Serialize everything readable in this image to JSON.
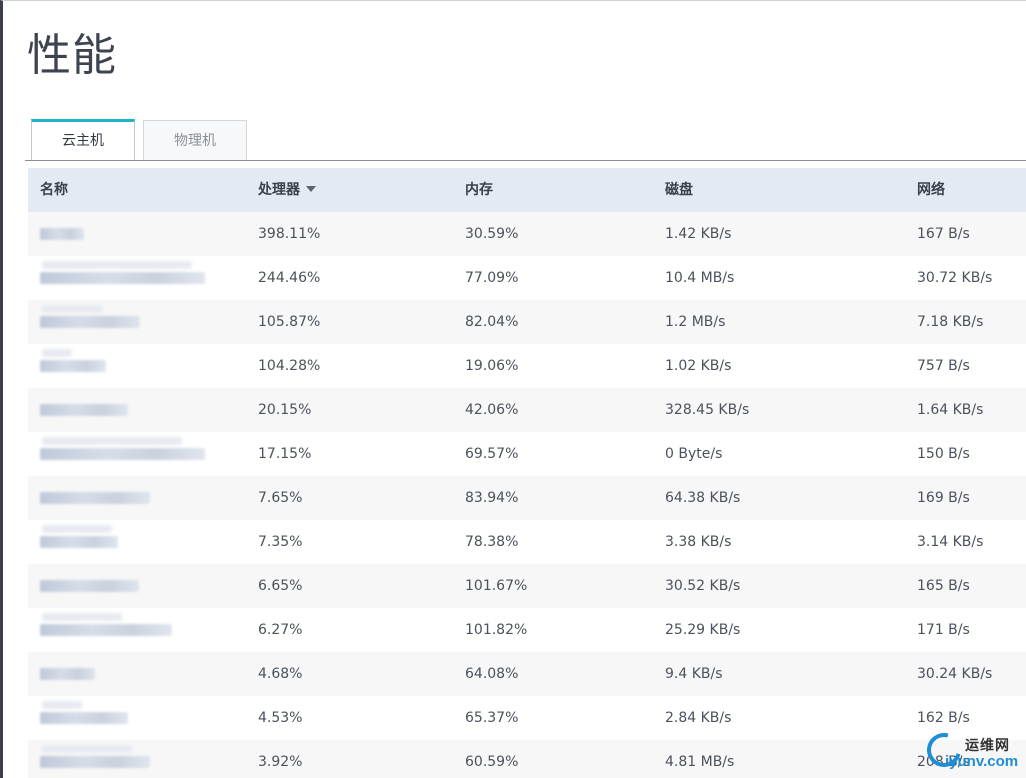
{
  "page": {
    "title": "性能"
  },
  "tabs": [
    {
      "label": "云主机",
      "active": true
    },
    {
      "label": "物理机",
      "active": false
    }
  ],
  "table": {
    "headers": {
      "name": "名称",
      "cpu": "处理器",
      "memory": "内存",
      "disk": "磁盘",
      "network": "网络"
    },
    "sort_column": "cpu",
    "sort_direction": "desc",
    "rows": [
      {
        "cpu": "398.11%",
        "memory": "30.59%",
        "disk": "1.42 KB/s",
        "network": "167 B/s"
      },
      {
        "cpu": "244.46%",
        "memory": "77.09%",
        "disk": "10.4 MB/s",
        "network": "30.72 KB/s"
      },
      {
        "cpu": "105.87%",
        "memory": "82.04%",
        "disk": "1.2 MB/s",
        "network": "7.18 KB/s"
      },
      {
        "cpu": "104.28%",
        "memory": "19.06%",
        "disk": "1.02 KB/s",
        "network": "757 B/s"
      },
      {
        "cpu": "20.15%",
        "memory": "42.06%",
        "disk": "328.45 KB/s",
        "network": "1.64 KB/s"
      },
      {
        "cpu": "17.15%",
        "memory": "69.57%",
        "disk": "0 Byte/s",
        "network": "150 B/s"
      },
      {
        "cpu": "7.65%",
        "memory": "83.94%",
        "disk": "64.38 KB/s",
        "network": "169 B/s"
      },
      {
        "cpu": "7.35%",
        "memory": "78.38%",
        "disk": "3.38 KB/s",
        "network": "3.14 KB/s"
      },
      {
        "cpu": "6.65%",
        "memory": "101.67%",
        "disk": "30.52 KB/s",
        "network": "165 B/s"
      },
      {
        "cpu": "6.27%",
        "memory": "101.82%",
        "disk": "25.29 KB/s",
        "network": "171 B/s"
      },
      {
        "cpu": "4.68%",
        "memory": "64.08%",
        "disk": "9.4 KB/s",
        "network": "30.24 KB/s"
      },
      {
        "cpu": "4.53%",
        "memory": "65.37%",
        "disk": "2.84 KB/s",
        "network": "162 B/s"
      },
      {
        "cpu": "3.92%",
        "memory": "60.59%",
        "disk": "4.81 MB/s",
        "network": "208 B/s"
      }
    ]
  },
  "watermark": {
    "line1": "运维网",
    "line2": "iyunv.com"
  },
  "colors": {
    "accent": "#1fb3c9",
    "header_bg": "#e3eaf2",
    "row_alt": "#f7f7f7",
    "sidebar_edge": "#3a3f4a",
    "watermark_blue": "#1e8fd6"
  }
}
